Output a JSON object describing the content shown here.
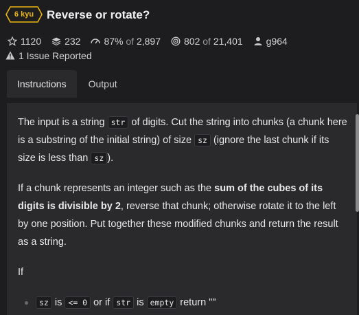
{
  "kata": {
    "rank": "6 kyu",
    "title": "Reverse or rotate?"
  },
  "stats": {
    "stars": "1120",
    "collections": "232",
    "satisfaction": "87%",
    "satisfaction_of": "of",
    "satisfaction_total": "2,897",
    "completed": "802",
    "completed_of": "of",
    "completed_total": "21,401",
    "author": "g964"
  },
  "issues": "1 Issue Reported",
  "tabs": [
    {
      "label": "Instructions",
      "active": true
    },
    {
      "label": "Output",
      "active": false
    }
  ],
  "description": {
    "p1_a": "The input is a string ",
    "p1_code1": "str",
    "p1_b": " of digits. Cut the string into chunks (a chunk here is a substring of the initial string) of size ",
    "p1_code2": "sz",
    "p1_c": " (ignore the last chunk if its size is less than ",
    "p1_code3": "sz",
    "p1_d": ").",
    "p2_a": "If a chunk represents an integer such as the ",
    "p2_bold": "sum of the cubes of its digits is divisible by 2",
    "p2_b": ", reverse that chunk; otherwise rotate it to the left by one position. Put together these modified chunks and return the result as a string.",
    "p3": "If",
    "b1_code1": "sz",
    "b1_t1": " is ",
    "b1_code2": "<= 0",
    "b1_t2": " or if ",
    "b1_code3": "str",
    "b1_t3": " is ",
    "b1_code4": "empty",
    "b1_t4": " return \"\""
  },
  "colors": {
    "background": "#1d1d1f",
    "panel": "#2a2a2d",
    "rank_yellow": "#ecb613"
  },
  "icons": [
    "star-icon",
    "layers-icon",
    "satisfaction-icon",
    "target-icon",
    "user-icon",
    "warning-icon"
  ]
}
